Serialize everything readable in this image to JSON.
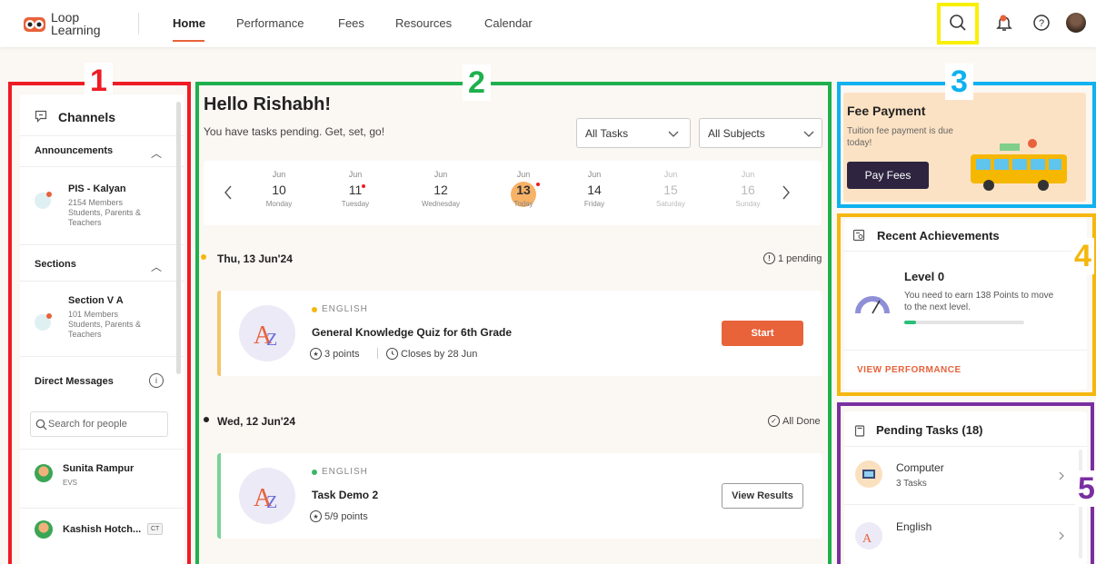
{
  "app": {
    "logo_line1": "Loop",
    "logo_line2": "Learning"
  },
  "nav": [
    {
      "label": "Home"
    },
    {
      "label": "Performance"
    },
    {
      "label": "Fees"
    },
    {
      "label": "Resources"
    },
    {
      "label": "Calendar"
    }
  ],
  "regions": {
    "r1": "1",
    "r2": "2",
    "r3": "3",
    "r4": "4",
    "r5": "5"
  },
  "colors": {
    "red": "#ee1c24",
    "green": "#1fb04d",
    "blue": "#0fb1ef",
    "yellow": "#f8d000",
    "gold": "#f5b70f",
    "purple": "#7a2fa0",
    "accent": "#e8623a"
  },
  "channels": {
    "title": "Channels",
    "announcements": {
      "label": "Announcements",
      "item": {
        "name": "PIS - Kalyan",
        "meta1": "2154 Members",
        "meta2": "Students, Parents &",
        "meta3": "Teachers"
      }
    },
    "sections": {
      "label": "Sections",
      "item": {
        "name": "Section V A",
        "meta1": "101 Members",
        "meta2": "Students, Parents &",
        "meta3": "Teachers"
      }
    },
    "dm": {
      "label": "Direct Messages",
      "search_placeholder": "Search for people",
      "people": [
        {
          "name": "Sunita Rampur",
          "sub": "EVS"
        },
        {
          "name": "Kashish Hotch...",
          "badge": "CT"
        }
      ]
    }
  },
  "main": {
    "greeting": "Hello Rishabh!",
    "subtitle": "You have tasks pending. Get, set, go!",
    "filter_tasks": "All Tasks",
    "filter_subjects": "All Subjects",
    "days": [
      {
        "m": "Jun",
        "d": "10",
        "w": "Monday"
      },
      {
        "m": "Jun",
        "d": "11",
        "w": "Tuesday"
      },
      {
        "m": "Jun",
        "d": "12",
        "w": "Wednesday"
      },
      {
        "m": "Jun",
        "d": "13",
        "w": "Today"
      },
      {
        "m": "Jun",
        "d": "14",
        "w": "Friday"
      },
      {
        "m": "Jun",
        "d": "15",
        "w": "Saturday"
      },
      {
        "m": "Jun",
        "d": "16",
        "w": "Sunday"
      }
    ],
    "group1": {
      "date": "Thu, 13 Jun'24",
      "status": "1 pending"
    },
    "task1": {
      "subject": "ENGLISH",
      "title": "General Knowledge Quiz for 6th Grade",
      "points": "3 points",
      "closes": "Closes by 28 Jun",
      "action": "Start"
    },
    "group2": {
      "date": "Wed, 12 Jun'24",
      "status": "All Done"
    },
    "task2": {
      "subject": "ENGLISH",
      "title": "Task Demo 2",
      "points": "5/9 points",
      "action": "View Results"
    }
  },
  "fee": {
    "title": "Fee Payment",
    "line1": "Tuition fee payment is due",
    "line2": "today!",
    "button": "Pay Fees"
  },
  "achievements": {
    "title": "Recent Achievements",
    "level": "Level 0",
    "line1": "You need to earn 138 Points to move",
    "line2": "to the next level.",
    "progress": 0.1,
    "link": "VIEW PERFORMANCE"
  },
  "pending": {
    "title": "Pending Tasks (18)",
    "items": [
      {
        "subject": "Computer",
        "count": "3 Tasks"
      },
      {
        "subject": "English"
      }
    ]
  }
}
